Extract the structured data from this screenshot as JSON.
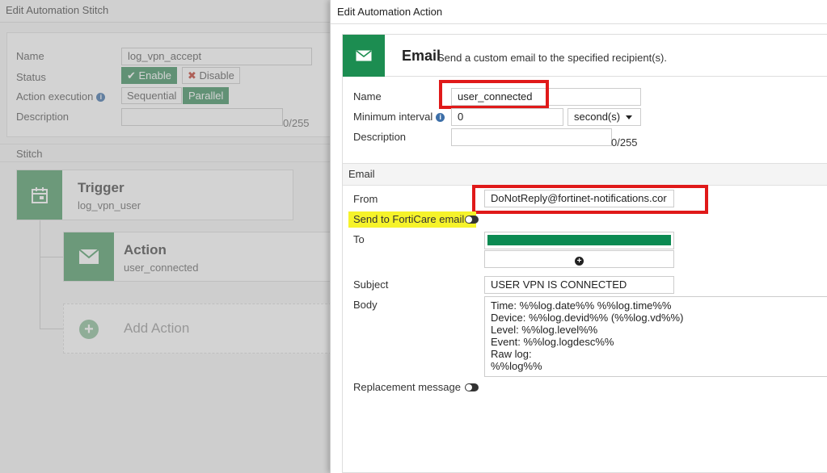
{
  "background": {
    "header_title": "Edit Automation Stitch",
    "fields": {
      "name_label": "Name",
      "name_value": "log_vpn_accept",
      "status_label": "Status",
      "enable_label": "Enable",
      "disable_label": "Disable",
      "action_exec_label": "Action execution",
      "sequential_label": "Sequential",
      "parallel_label": "Parallel",
      "description_label": "Description",
      "description_count": "0/255"
    },
    "stitch_label": "Stitch",
    "trigger": {
      "title": "Trigger",
      "subtitle": "log_vpn_user"
    },
    "action": {
      "title": "Action",
      "subtitle": "user_connected"
    },
    "add_action": {
      "title": "Add Action"
    }
  },
  "dialog": {
    "header_title": "Edit Automation Action",
    "action_type": {
      "title": "Email",
      "description": "Send a custom email to the specified recipient(s)."
    },
    "fields": {
      "name_label": "Name",
      "name_value": "user_connected",
      "min_interval_label": "Minimum interval",
      "min_interval_value": "0",
      "interval_unit": "second(s)",
      "description_label": "Description",
      "description_count": "0/255"
    },
    "email_section": {
      "title": "Email",
      "from_label": "From",
      "from_value": "DoNotReply@fortinet-notifications.cor",
      "forticare_label": "Send to FortiCare email",
      "to_label": "To",
      "subject_label": "Subject",
      "subject_value": "USER VPN IS CONNECTED",
      "body_label": "Body",
      "body_lines": [
        "Time: %%log.date%% %%log.time%%",
        "Device: %%log.devid%% (%%log.vd%%)",
        "Level: %%log.level%%",
        "Event: %%log.logdesc%%",
        "Raw log:",
        "%%log%%"
      ],
      "replacement_label": "Replacement message"
    }
  },
  "colors": {
    "accent_green": "#1c8d51",
    "annotation_red": "#e01919",
    "annotation_yellow": "#f6f32a",
    "info_blue": "#3d6fa8"
  }
}
